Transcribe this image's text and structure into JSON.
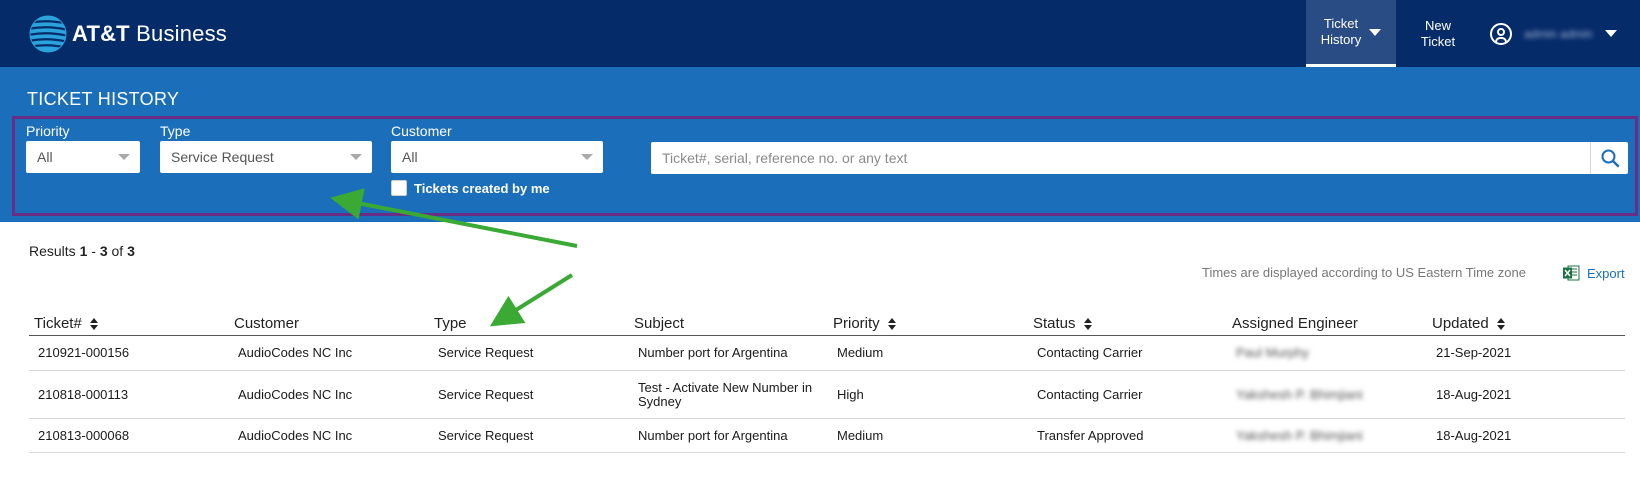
{
  "brand": {
    "name_bold": "AT&T",
    "name_rest": " Business",
    "logo_icon": "att-globe-icon",
    "color": "#062b69"
  },
  "nav": {
    "history_line1": "Ticket",
    "history_line2": "History",
    "new_line1": "New",
    "new_line2": "Ticket",
    "user_name": "admin admin"
  },
  "page": {
    "title": "TICKET HISTORY"
  },
  "filters": {
    "priority_label": "Priority",
    "priority_value": "All",
    "type_label": "Type",
    "type_value": "Service Request",
    "customer_label": "Customer",
    "customer_value": "All",
    "search_placeholder": "Ticket#, serial, reference no. or any text",
    "created_by_me_label": "Tickets created by me",
    "created_by_me_checked": false
  },
  "results": {
    "prefix": "Results ",
    "from": "1",
    "sep": " - ",
    "to": "3",
    "of": " of ",
    "total": "3"
  },
  "timezone_note": "Times are displayed according to US Eastern Time zone",
  "export_label": "Export",
  "table": {
    "headers": [
      "Ticket#",
      "Customer",
      "Type",
      "Subject",
      "Priority",
      "Status",
      "Assigned Engineer",
      "Updated"
    ],
    "rows": [
      [
        "210921-000156",
        "AudioCodes NC Inc",
        "Service Request",
        "Number port for Argentina",
        "Medium",
        "Contacting Carrier",
        "Paul Murphy",
        "21-Sep-2021"
      ],
      [
        "210818-000113",
        "AudioCodes NC Inc",
        "Service Request",
        "Test - Activate New Number in Sydney",
        "High",
        "Contacting Carrier",
        "Yakshesh P. Bhimjiani",
        "18-Aug-2021"
      ],
      [
        "210813-000068",
        "AudioCodes NC Inc",
        "Service Request",
        "Number port for Argentina",
        "Medium",
        "Transfer Approved",
        "Yakshesh P. Bhimjiani",
        "18-Aug-2021"
      ]
    ]
  },
  "colors": {
    "topbar": "#062b69",
    "band": "#1b6eba",
    "highlight_box": "#6a2d86",
    "arrow": "#3aaa35"
  }
}
